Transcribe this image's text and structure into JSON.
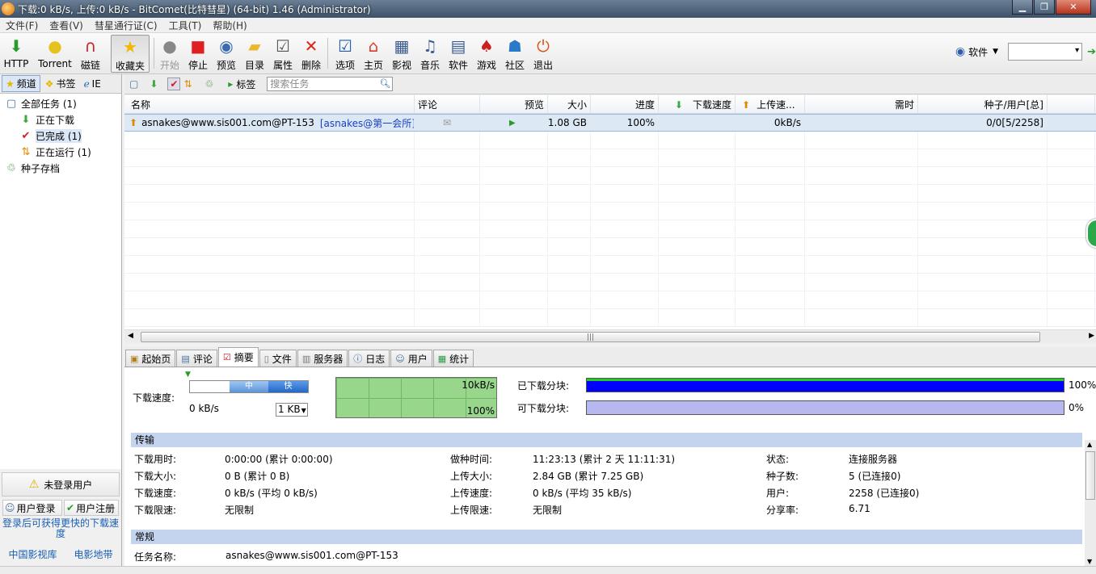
{
  "title_bar": {
    "text": "下载:0 kB/s, 上传:0 kB/s - BitComet(比特彗星) (64-bit) 1.46 (Administrator)"
  },
  "menu": [
    "文件(F)",
    "查看(V)",
    "彗星通行证(C)",
    "工具(T)",
    "帮助(H)"
  ],
  "toolbar": {
    "http": "HTTP",
    "torrent": "Torrent",
    "magnet": "磁链",
    "favorites": "收藏夹",
    "start": "开始",
    "stop": "停止",
    "preview": "预览",
    "directory": "目录",
    "properties": "属性",
    "delete": "删除",
    "options": "选项",
    "home": "主页",
    "movies": "影视",
    "music": "音乐",
    "software": "软件",
    "games": "游戏",
    "community": "社区",
    "exit": "退出",
    "search_category": "软件"
  },
  "left_tabs": [
    "频道",
    "书签",
    "IE"
  ],
  "tree": {
    "all": "全部任务 (1)",
    "downloading": "正在下载",
    "completed": "已完成 (1)",
    "running": "正在运行 (1)",
    "archive": "种子存档"
  },
  "task_toolbar": {
    "tags": "标签",
    "search_placeholder": "搜索任务"
  },
  "columns": {
    "name": "名称",
    "comment": "评论",
    "preview": "预览",
    "size": "大小",
    "progress": "进度",
    "down_speed": "下载速度",
    "up_speed": "上传速...",
    "time_left": "需时",
    "seeds_peers": "种子/用户[总]"
  },
  "task": {
    "name": "asnakes@www.sis001.com@PT-153",
    "tag": "[asnakes@第一会所]",
    "size": "1.08 GB",
    "progress": "100%",
    "up_speed": "0kB/s",
    "seeds_peers": "0/0[5/2258]"
  },
  "user_panel": {
    "not_logged": "未登录用户",
    "login": "用户登录",
    "register": "用户注册",
    "hint": "登录后可获得更快的下载速度",
    "link1": "中国影视库",
    "link2": "电影地带"
  },
  "bottom_tabs": [
    "起始页",
    "评论",
    "摘要",
    "文件",
    "服务器",
    "日志",
    "用户",
    "统计"
  ],
  "summary": {
    "speed_label": "下载速度:",
    "speed_value": "0 kB/s",
    "speed_mid": "中",
    "speed_fast": "快",
    "unit_select": "1 KB",
    "graph_top": "10kB/s",
    "graph_bottom": "100%",
    "downloaded_blocks_label": "已下载分块:",
    "downloaded_blocks_pct": "100%",
    "available_blocks_label": "可下载分块:",
    "available_blocks_pct": "0%"
  },
  "transfer": {
    "section": "传输",
    "dl_time_label": "下载用时:",
    "dl_time": "0:00:00 (累计 0:00:00)",
    "seed_time_label": "做种时间:",
    "seed_time": "11:23:13 (累计 2 天 11:11:31)",
    "state_label": "状态:",
    "state": "连接服务器",
    "dl_size_label": "下载大小:",
    "dl_size": "0 B (累计 0 B)",
    "ul_size_label": "上传大小:",
    "ul_size": "2.84 GB (累计 7.25 GB)",
    "seeds_label": "种子数:",
    "seeds": "5 (已连接0)",
    "dl_speed_label": "下载速度:",
    "dl_speed": "0 kB/s (平均 0 kB/s)",
    "ul_speed_label": "上传速度:",
    "ul_speed": "0 kB/s (平均 35 kB/s)",
    "peers_label": "用户:",
    "peers": "2258 (已连接0)",
    "dl_limit_label": "下载限速:",
    "dl_limit": "无限制",
    "ul_limit_label": "上传限速:",
    "ul_limit": "无限制",
    "ratio_label": "分享率:",
    "ratio": "6.71"
  },
  "general": {
    "section": "常规",
    "task_name_label": "任务名称:",
    "task_name": "asnakes@www.sis001.com@PT-153"
  }
}
